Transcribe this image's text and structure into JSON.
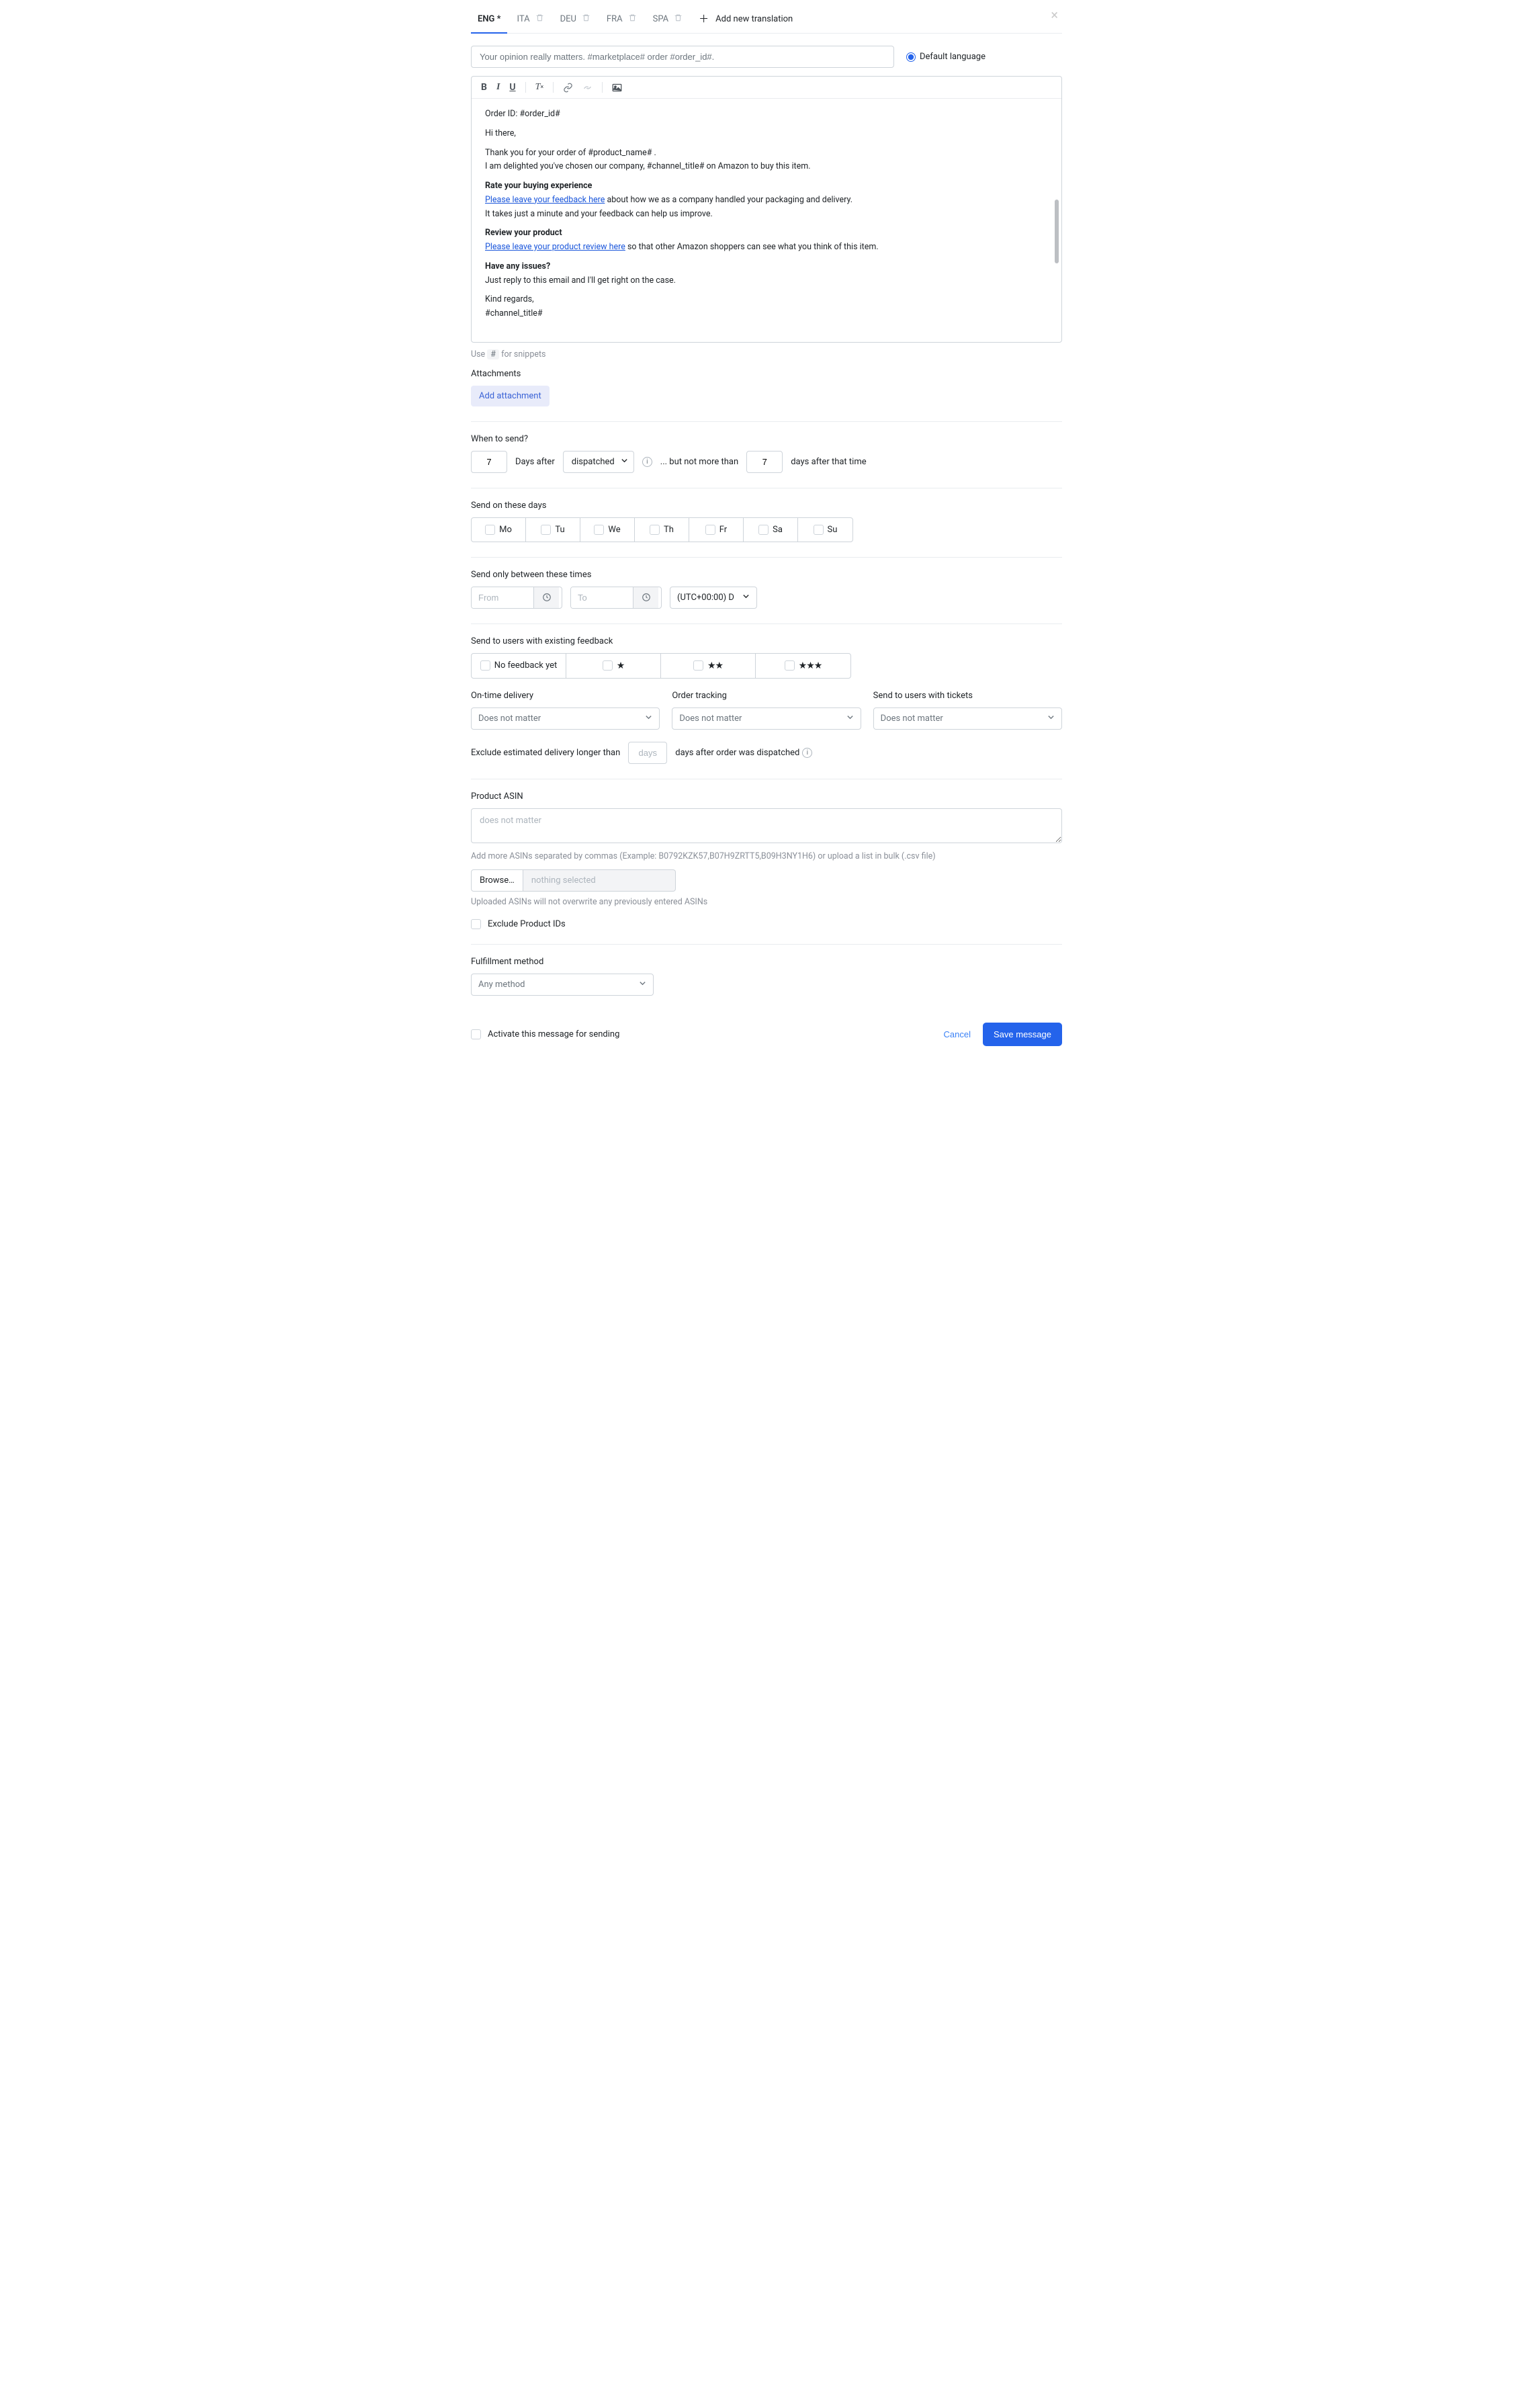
{
  "tabs": {
    "eng": "ENG *",
    "ita": "ITA",
    "deu": "DEU",
    "fra": "FRA",
    "spa": "SPA",
    "add": "Add new translation"
  },
  "subject": {
    "value": "Your opinion really matters. #marketplace# order #order_id#."
  },
  "default_lang_label": "Default language",
  "body": {
    "order_id_label": "Order ID: #order_id#",
    "hi": "Hi there,",
    "thanks_l1": "Thank you for your order of #product_name# .",
    "thanks_l2": "I am delighted you've chosen our company, #channel_title# on Amazon to buy this item.",
    "rate_head": "Rate your buying experience",
    "rate_link": "Please leave your feedback here",
    "rate_tail": " about how we as a company handled your packaging and delivery.",
    "rate_l2": "It takes just a minute and your feedback can help us improve.",
    "review_head": "Review your product",
    "review_link": "Please leave your product review here",
    "review_tail": " so that other Amazon shoppers can see what you think of this item.",
    "issues_head": "Have any issues?",
    "issues_l1": "Just reply to this email and I'll get right on the case.",
    "regards": "Kind regards,",
    "sig": "#channel_title#"
  },
  "snippets_note": {
    "pre": "Use ",
    "hash": "#",
    "post": " for snippets"
  },
  "attachments": {
    "label": "Attachments",
    "button": "Add attachment"
  },
  "when": {
    "label": "When to send?",
    "n1": "7",
    "days_after": "Days after",
    "event": "dispatched",
    "mid": "... but not more than",
    "n2": "7",
    "tail": "days after that time"
  },
  "days": {
    "label": "Send on these days",
    "mo": "Mo",
    "tu": "Tu",
    "we": "We",
    "th": "Th",
    "fr": "Fr",
    "sa": "Sa",
    "su": "Su"
  },
  "times": {
    "label": "Send only between these times",
    "from_ph": "From",
    "to_ph": "To",
    "tz": "(UTC+00:00) D…"
  },
  "feedback": {
    "label": "Send to users with existing feedback",
    "none": "No feedback yet",
    "s1": "★",
    "s2": "★★",
    "s3": "★★★"
  },
  "selects": {
    "ontime_label": "On-time delivery",
    "tracking_label": "Order tracking",
    "tickets_label": "Send to users with tickets",
    "opt": "Does not matter"
  },
  "exclude_delivery": {
    "pre": "Exclude estimated delivery longer than",
    "ph": "days",
    "post": "days after order was dispatched"
  },
  "asin": {
    "label": "Product ASIN",
    "ph": "does not matter",
    "help": "Add more ASINs separated by commas (Example: B0792KZK57,B07H9ZRTT5,B09H3NY1H6) or upload a list in bulk (.csv file)",
    "browse": "Browse…",
    "nothing": "nothing selected",
    "note": "Uploaded ASINs will not overwrite any previously entered ASINs",
    "exclude_ids": "Exclude Product IDs"
  },
  "fulfill": {
    "label": "Fulfillment method",
    "opt": "Any method"
  },
  "footer": {
    "activate": "Activate this message for sending",
    "cancel": "Cancel",
    "save": "Save message"
  }
}
